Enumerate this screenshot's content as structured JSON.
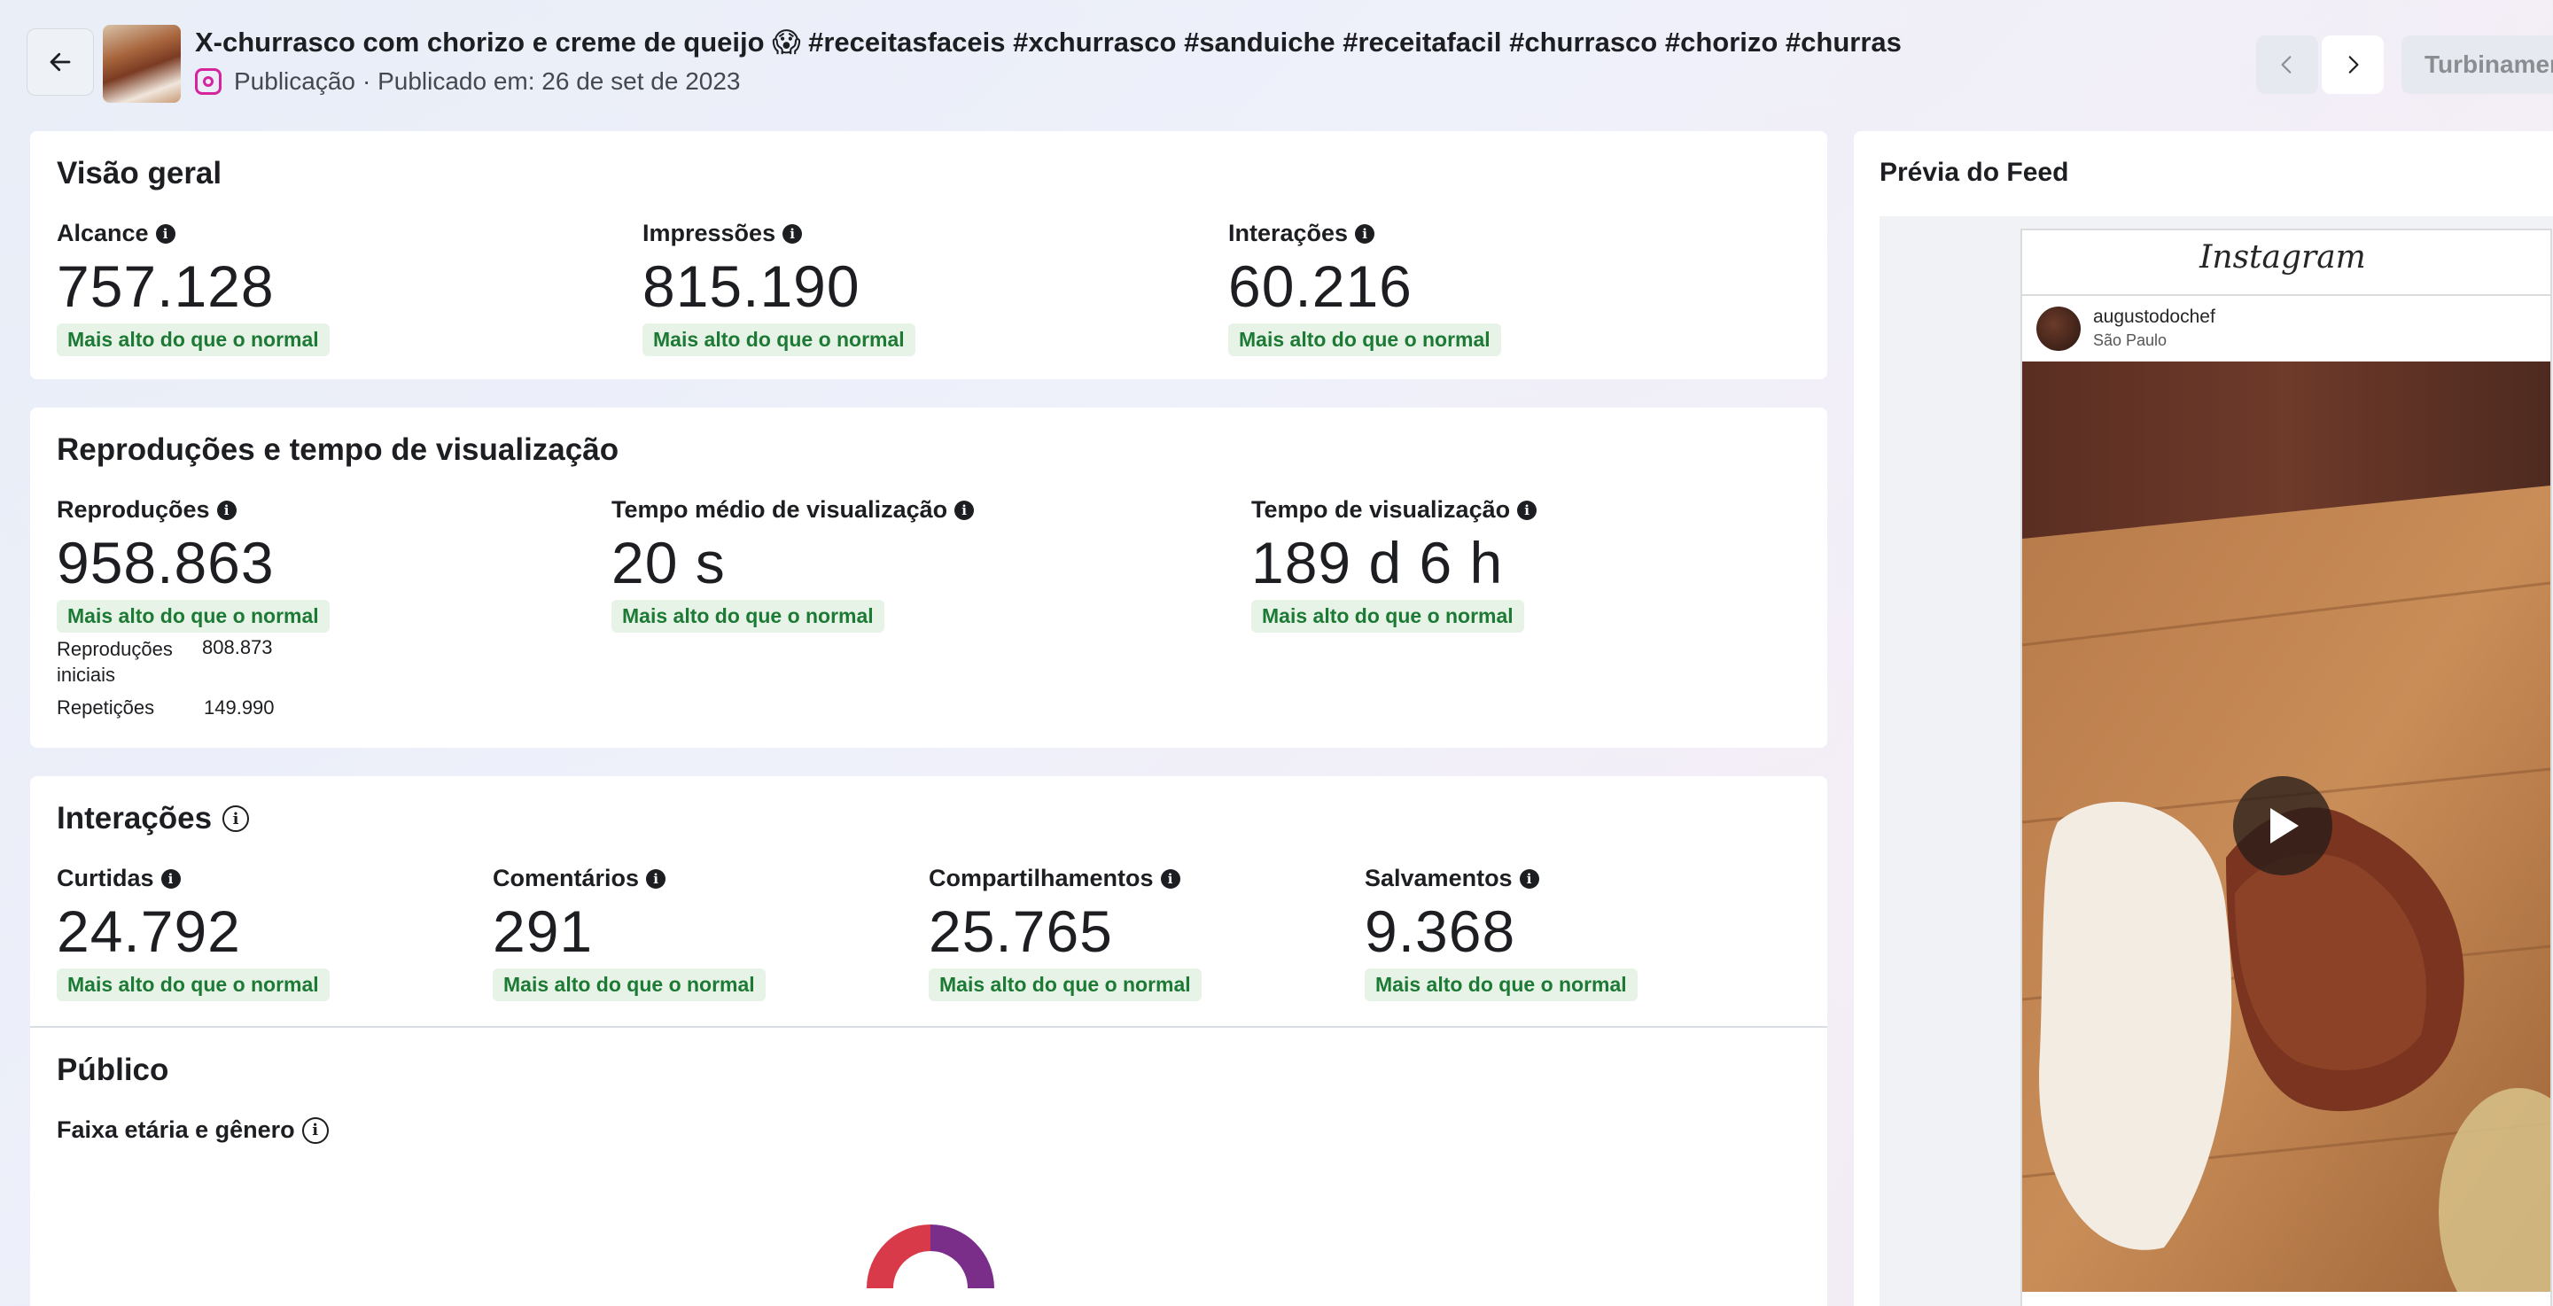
{
  "header": {
    "title": "X-churrasco com chorizo e creme de queijo 😱 #receitasfaceis #xchurrasco #sanduiche #receitafacil #churrasco #chorizo #churras",
    "post_type": "Publicação",
    "published": "· Publicado em: 26 de set de 2023",
    "boost_label": "Turbinamen"
  },
  "overview": {
    "title": "Visão geral",
    "metrics": [
      {
        "label": "Alcance",
        "value": "757.128",
        "badge": "Mais alto do que o normal"
      },
      {
        "label": "Impressões",
        "value": "815.190",
        "badge": "Mais alto do que o normal"
      },
      {
        "label": "Interações",
        "value": "60.216",
        "badge": "Mais alto do que o normal"
      }
    ]
  },
  "plays": {
    "title": "Reproduções e tempo de visualização",
    "metrics": [
      {
        "label": "Reproduções",
        "value": "958.863",
        "badge": "Mais alto do que o normal"
      },
      {
        "label": "Tempo médio de visualização",
        "value": "20 s",
        "badge": "Mais alto do que o normal"
      },
      {
        "label": "Tempo de visualização",
        "value": "189 d 6 h",
        "badge": "Mais alto do que o normal"
      }
    ],
    "breakdown": [
      {
        "label_line1": "Reproduções",
        "label_line2": "iniciais",
        "value": "808.873"
      },
      {
        "label_line1": "Repetições",
        "label_line2": "",
        "value": "149.990"
      }
    ]
  },
  "interactions": {
    "title": "Interações",
    "metrics": [
      {
        "label": "Curtidas",
        "value": "24.792",
        "badge": "Mais alto do que o normal"
      },
      {
        "label": "Comentários",
        "value": "291",
        "badge": "Mais alto do que o normal"
      },
      {
        "label": "Compartilhamentos",
        "value": "25.765",
        "badge": "Mais alto do que o normal"
      },
      {
        "label": "Salvamentos",
        "value": "9.368",
        "badge": "Mais alto do que o normal"
      }
    ]
  },
  "audience": {
    "title": "Público",
    "subtitle": "Faixa etária e gênero",
    "colors": {
      "segment_a": "#d93a4a",
      "segment_b": "#7a2e8a"
    }
  },
  "feed": {
    "title": "Prévia do Feed",
    "logo": "Instagram",
    "username": "augustodochef",
    "location": "São Paulo"
  }
}
